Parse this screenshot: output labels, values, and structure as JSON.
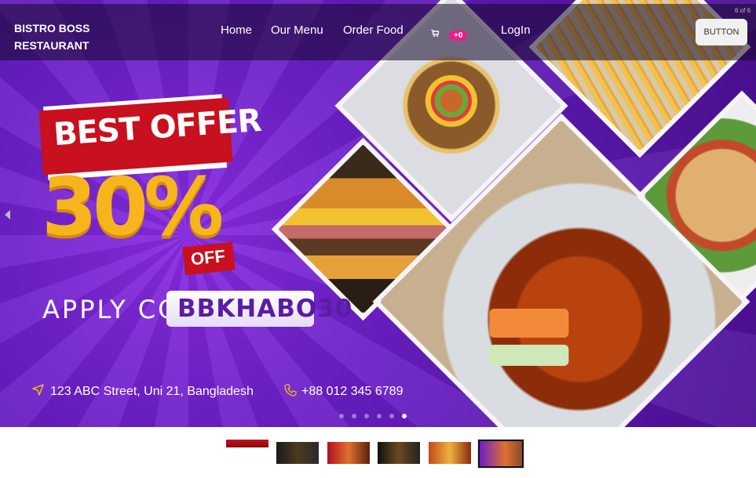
{
  "brand": {
    "line1": "BISTRO BOSS",
    "line2": "RESTAURANT"
  },
  "nav": {
    "home": "Home",
    "menu": "Our Menu",
    "order": "Order Food",
    "login": "LogIn",
    "button": "BUTTON"
  },
  "cart": {
    "icon": "cart-icon",
    "badge": "+0"
  },
  "slider": {
    "counter": "6 of 6",
    "active_index": 6,
    "total": 6
  },
  "offer": {
    "banner": "BEST OFFER",
    "percent": "30%",
    "off": "OFF",
    "apply": "APPLY CODE",
    "code": "BBKHABO30"
  },
  "contact": {
    "address": "123 ABC Street, Uni 21, Bangladesh",
    "phone": "+88 012 345 6789",
    "address_icon": "location-arrow-icon",
    "phone_icon": "phone-icon"
  },
  "colors": {
    "hero_purple": "#6a1fc7",
    "accent_red": "#c8101e",
    "accent_gold": "#f6b51d",
    "badge_pink": "#e91e8c"
  }
}
